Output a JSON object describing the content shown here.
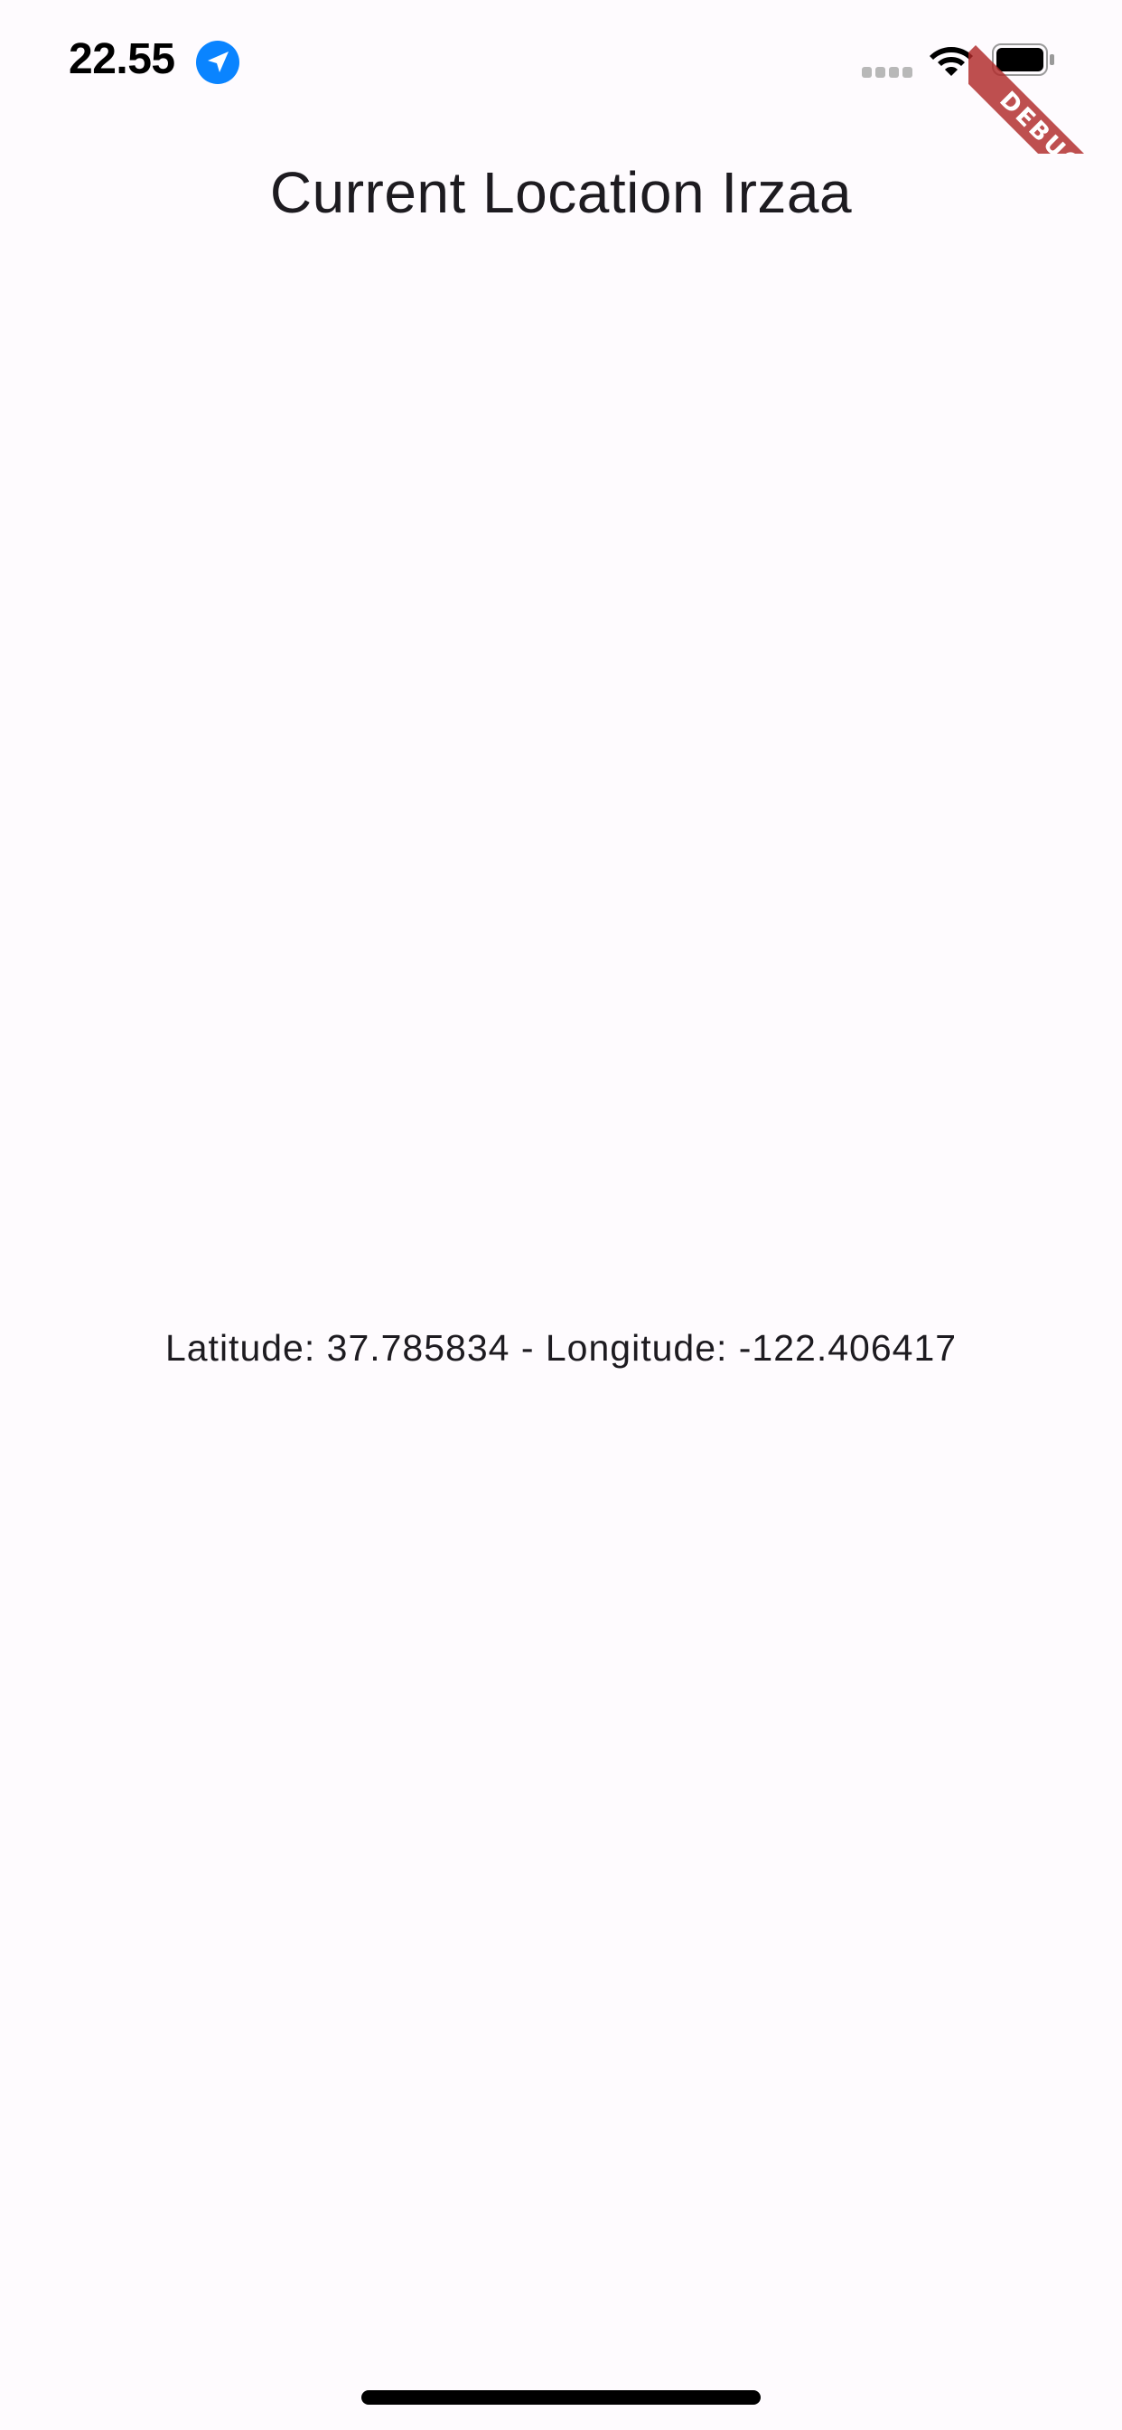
{
  "status_bar": {
    "time": "22.55",
    "icons": [
      "location-arrow-icon",
      "cellular-signal-icon",
      "wifi-icon",
      "battery-icon"
    ]
  },
  "debug_banner": {
    "label": "DEBUG",
    "color": "#b02828"
  },
  "app_bar": {
    "title": "Current Location Irzaa"
  },
  "body": {
    "coordinates_text": "Latitude: 37.785834 - Longitude: -122.406417"
  },
  "colors": {
    "background": "#fefbfe",
    "text": "#1d1b20",
    "accent": "#0a84ff"
  }
}
